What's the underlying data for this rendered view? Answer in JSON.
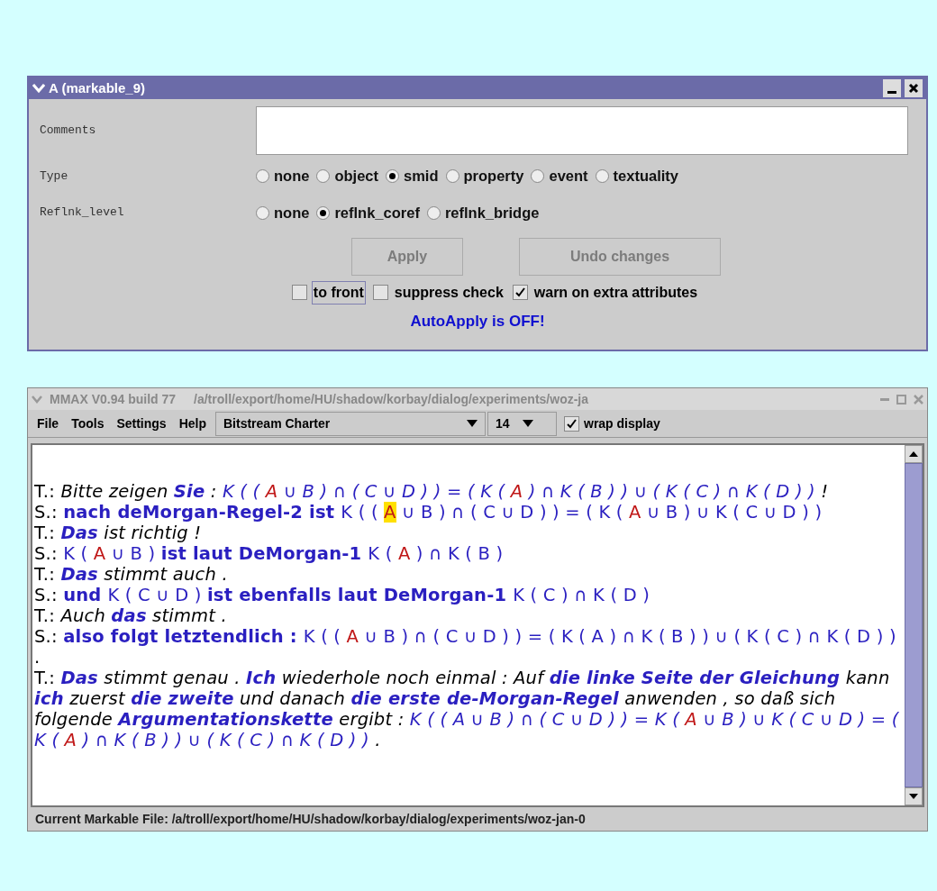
{
  "attribute_window": {
    "title": "A (markable_9)",
    "fields": [
      {
        "kind": "text",
        "label": "Comments"
      },
      {
        "kind": "radio",
        "label": "Type",
        "options": [
          {
            "label": "none",
            "selected": false
          },
          {
            "label": "object",
            "selected": false
          },
          {
            "label": "smid",
            "selected": true
          },
          {
            "label": "property",
            "selected": false
          },
          {
            "label": "event",
            "selected": false
          },
          {
            "label": "textuality",
            "selected": false
          }
        ]
      },
      {
        "kind": "radio",
        "label": "Reflnk_level",
        "options": [
          {
            "label": "none",
            "selected": false
          },
          {
            "label": "reflnk_coref",
            "selected": true
          },
          {
            "label": "reflnk_bridge",
            "selected": false
          }
        ]
      }
    ],
    "buttons": [
      {
        "label": "Apply",
        "disabled": true
      },
      {
        "label": "Undo changes",
        "disabled": true
      }
    ],
    "checkboxes": [
      {
        "label": "to front",
        "checked": false,
        "focused": true
      },
      {
        "label": "suppress check",
        "checked": false,
        "focused": false
      },
      {
        "label": "warn on extra attributes",
        "checked": true,
        "focused": false
      }
    ],
    "status": "AutoApply is OFF!"
  },
  "main_window": {
    "title": "MMAX V0.94 build 77",
    "path": "/a/troll/export/home/HU/shadow/korbay/dialog/experiments/woz-ja",
    "menu": [
      "File",
      "Tools",
      "Settings",
      "Help"
    ],
    "font_select": "Bitstream Charter",
    "size_select": "14",
    "wrap_display": {
      "label": "wrap display",
      "checked": true
    },
    "utterances": [
      {
        "speaker": "T.:",
        "segments": [
          {
            "kind": "i",
            "text": "Bitte zeigen "
          },
          {
            "kind": "bi",
            "text": "Sie"
          },
          {
            "kind": "i",
            "text": " : "
          },
          {
            "kind": "mi",
            "text": "K ( ( "
          },
          {
            "kind": "ri",
            "text": "A"
          },
          {
            "kind": "mi",
            "text": " ∪ B ) ∩ ( C ∪ D ) ) = ( K ( "
          },
          {
            "kind": "ri",
            "text": "A"
          },
          {
            "kind": "mi",
            "text": " ) ∩ K ( B ) ) ∪ ( K ( C ) ∩ K ( D ) ) "
          },
          {
            "kind": "i",
            "text": "!"
          }
        ]
      },
      {
        "speaker": "S.:",
        "segments": [
          {
            "kind": "b",
            "text": "nach deMorgan-Regel-2 ist "
          },
          {
            "kind": "m",
            "text": "K ( ( "
          },
          {
            "kind": "rh",
            "text": "A"
          },
          {
            "kind": "m",
            "text": " ∪ B ) ∩ ( C ∪ D ) ) = ( K ( "
          },
          {
            "kind": "r",
            "text": "A"
          },
          {
            "kind": "m",
            "text": " ∪ B ) ∪ K ( C ∪ D ) )"
          }
        ]
      },
      {
        "speaker": "T.:",
        "segments": [
          {
            "kind": "bi",
            "text": "Das"
          },
          {
            "kind": "i",
            "text": " ist richtig !"
          }
        ]
      },
      {
        "speaker": "S.:",
        "segments": [
          {
            "kind": "m",
            "text": "K ( "
          },
          {
            "kind": "r",
            "text": "A"
          },
          {
            "kind": "m",
            "text": " ∪ B ) "
          },
          {
            "kind": "b",
            "text": "ist laut DeMorgan-1 "
          },
          {
            "kind": "m",
            "text": "K ( "
          },
          {
            "kind": "r",
            "text": "A"
          },
          {
            "kind": "m",
            "text": " ) ∩ K ( B )"
          }
        ]
      },
      {
        "speaker": "T.:",
        "segments": [
          {
            "kind": "bi",
            "text": "Das"
          },
          {
            "kind": "i",
            "text": " stimmt auch ."
          }
        ]
      },
      {
        "speaker": "S.:",
        "segments": [
          {
            "kind": "b",
            "text": "und "
          },
          {
            "kind": "m",
            "text": "K ( C ∪ D ) "
          },
          {
            "kind": "b",
            "text": "ist ebenfalls laut DeMorgan-1 "
          },
          {
            "kind": "m",
            "text": "K ( C ) ∩ K ( D )"
          }
        ]
      },
      {
        "speaker": "T.:",
        "segments": [
          {
            "kind": "i",
            "text": "Auch "
          },
          {
            "kind": "bi",
            "text": "das"
          },
          {
            "kind": "i",
            "text": " stimmt ."
          }
        ]
      },
      {
        "speaker": "S.:",
        "segments": [
          {
            "kind": "b",
            "text": "also folgt letztendlich : "
          },
          {
            "kind": "m",
            "text": "K ( ( "
          },
          {
            "kind": "r",
            "text": "A"
          },
          {
            "kind": "m",
            "text": " ∪ B ) ∩ ( C ∪ D ) ) = ( K ( A ) ∩ K ( B ) ) ∪ ( K ( C ) ∩ K ( D ) ) "
          },
          {
            "kind": "p",
            "text": "."
          }
        ]
      },
      {
        "speaker": "T.:",
        "segments": [
          {
            "kind": "bi",
            "text": "Das"
          },
          {
            "kind": "i",
            "text": " stimmt genau . "
          },
          {
            "kind": "bi",
            "text": "Ich"
          },
          {
            "kind": "i",
            "text": " wiederhole noch einmal : Auf "
          },
          {
            "kind": "bi",
            "text": "die linke Seite der Gleichung"
          },
          {
            "kind": "i",
            "text": " kann "
          },
          {
            "kind": "bi",
            "text": "ich"
          },
          {
            "kind": "i",
            "text": " zuerst "
          },
          {
            "kind": "bi",
            "text": "die zweite"
          },
          {
            "kind": "i",
            "text": " und danach "
          },
          {
            "kind": "bi",
            "text": "die erste de-Morgan-Regel"
          },
          {
            "kind": "i",
            "text": " anwenden , so daß sich folgende "
          },
          {
            "kind": "bi",
            "text": "Argumentationskette"
          },
          {
            "kind": "i",
            "text": " ergibt : "
          },
          {
            "kind": "mi",
            "text": "K ( ( A ∪ B ) ∩ ( C ∪ D ) ) = K ( "
          },
          {
            "kind": "ri",
            "text": "A"
          },
          {
            "kind": "mi",
            "text": " ∪ B ) ∪ K ( C ∪ D ) = ( K ( "
          },
          {
            "kind": "ri",
            "text": "A"
          },
          {
            "kind": "mi",
            "text": " ) ∩ K ( B ) ) ∪ ( K ( C ) ∩ K ( D ) ) "
          },
          {
            "kind": "i",
            "text": "."
          }
        ]
      }
    ],
    "status_bar": "Current Markable File: /a/troll/export/home/HU/shadow/korbay/dialog/experiments/woz-jan-0"
  }
}
